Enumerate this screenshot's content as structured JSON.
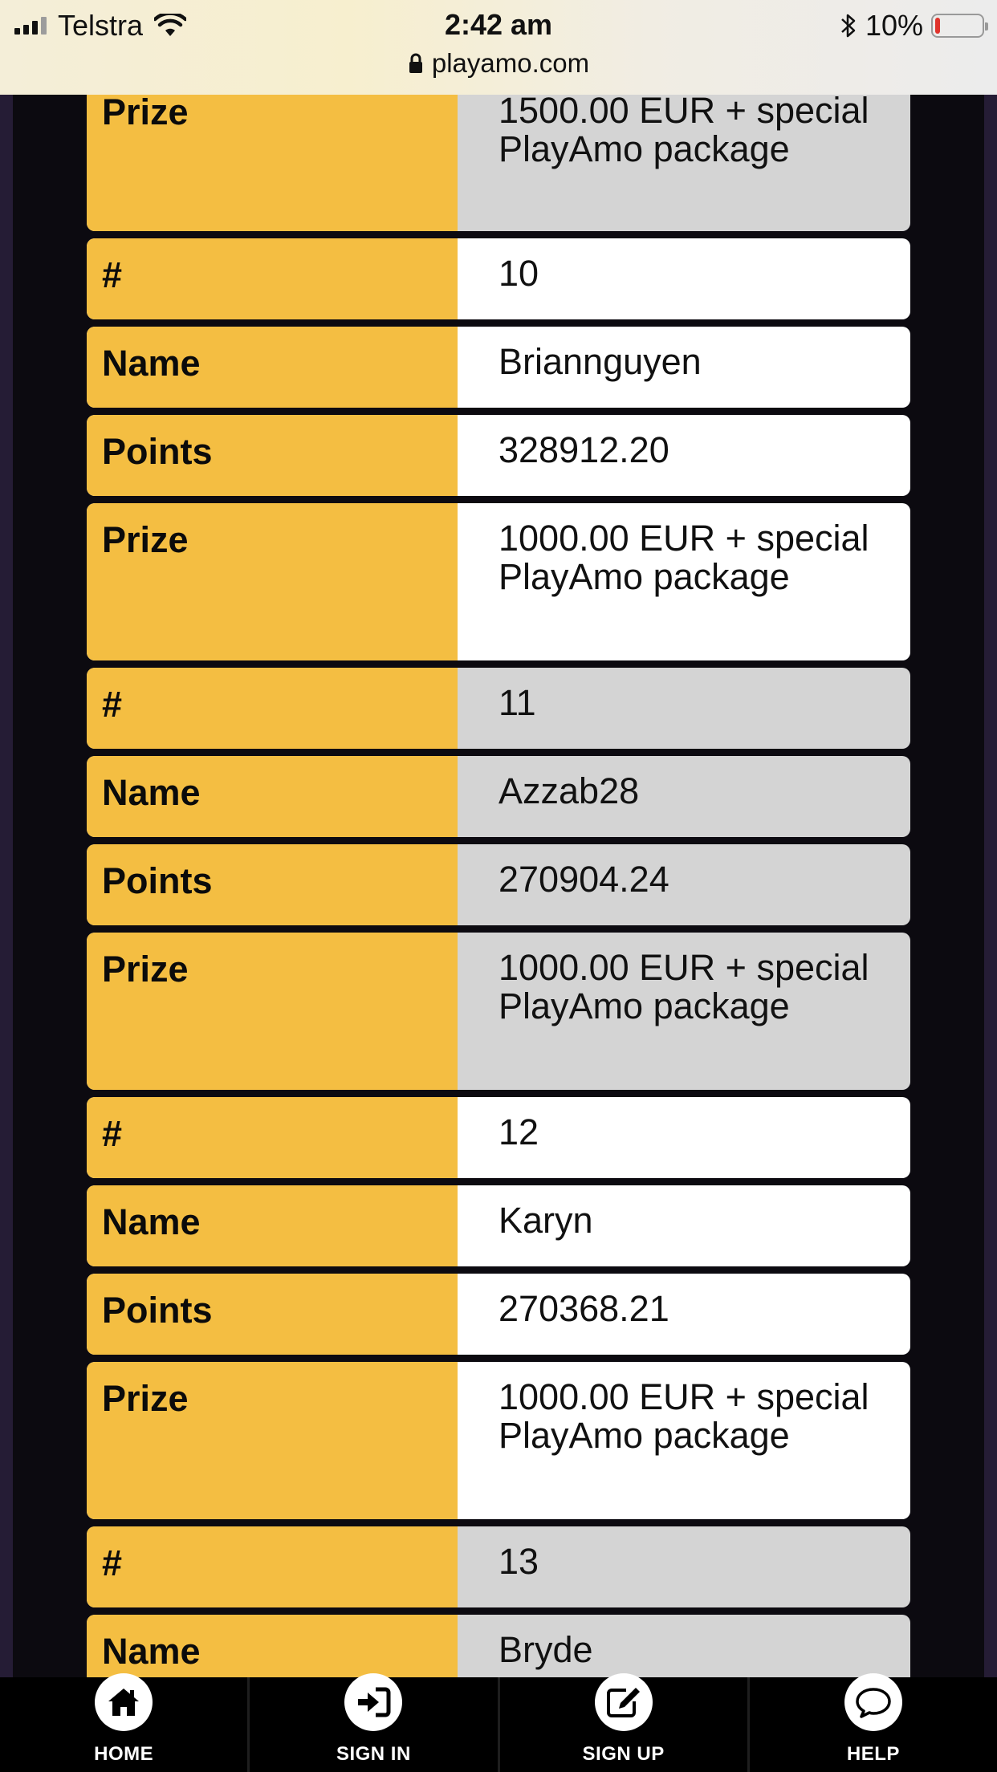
{
  "status_bar": {
    "carrier": "Telstra",
    "time": "2:42 am",
    "battery_text": "10%",
    "battery_level": 0.1,
    "url": "playamo.com"
  },
  "leaderboard": {
    "first_row": {
      "label": "Prize",
      "value": "1500.00 EUR + special PlayAmo package"
    },
    "entries": [
      {
        "rank_label": "#",
        "rank": "10",
        "name_label": "Name",
        "name": "Briannguyen",
        "points_label": "Points",
        "points": "328912.20",
        "prize_label": "Prize",
        "prize": "1000.00 EUR + special PlayAmo package",
        "shade": "white"
      },
      {
        "rank_label": "#",
        "rank": "11",
        "name_label": "Name",
        "name": "Azzab28",
        "points_label": "Points",
        "points": "270904.24",
        "prize_label": "Prize",
        "prize": "1000.00 EUR + special PlayAmo package",
        "shade": "gray"
      },
      {
        "rank_label": "#",
        "rank": "12",
        "name_label": "Name",
        "name": "Karyn",
        "points_label": "Points",
        "points": "270368.21",
        "prize_label": "Prize",
        "prize": "1000.00 EUR + special PlayAmo package",
        "shade": "white"
      },
      {
        "rank_label": "#",
        "rank": "13",
        "shade": "gray"
      }
    ],
    "partial_row": {
      "label": "Name",
      "value": "Bryde"
    }
  },
  "bottom_nav": [
    {
      "label": "HOME",
      "icon": "home-icon"
    },
    {
      "label": "SIGN IN",
      "icon": "sign-in-icon"
    },
    {
      "label": "SIGN UP",
      "icon": "sign-up-icon"
    },
    {
      "label": "HELP",
      "icon": "chat-bubble-icon"
    }
  ],
  "colors": {
    "label_bg": "#f4be42",
    "gray_row": "#d4d4d4",
    "page_bg": "#0c0a10"
  }
}
